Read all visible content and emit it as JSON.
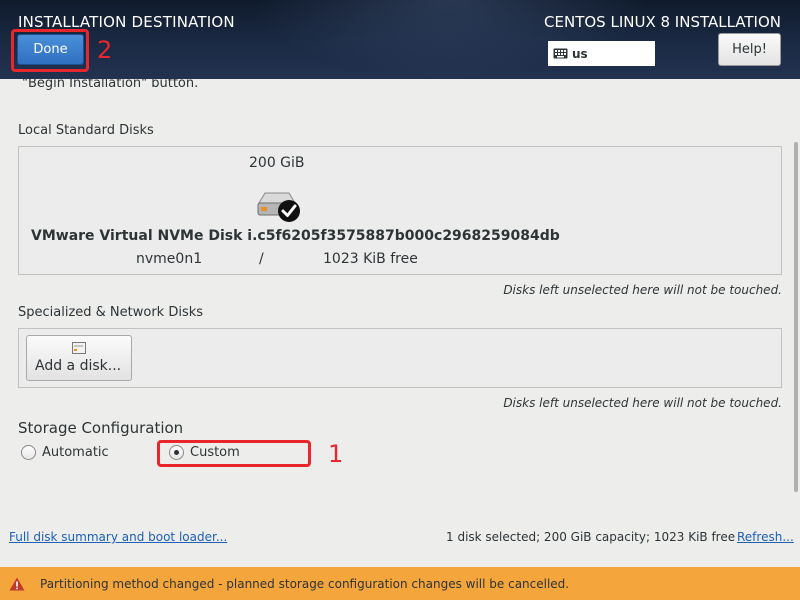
{
  "header": {
    "title": "INSTALLATION DESTINATION",
    "product": "CENTOS LINUX 8 INSTALLATION",
    "done_label": "Done",
    "keyboard_layout": "us",
    "help_label": "Help!"
  },
  "content": {
    "cut_text": "\"Begin Installation\" button.",
    "local_disks": {
      "label": "Local Standard Disks",
      "disk": {
        "size": "200 GiB",
        "name": "VMware Virtual NVMe Disk i.c5f6205f3575887b000c2968259084db",
        "device": "nvme0n1",
        "mount": "/",
        "free": "1023 KiB free",
        "selected": true
      },
      "note": "Disks left unselected here will not be touched."
    },
    "network_disks": {
      "label": "Specialized & Network Disks",
      "add_disk_label": "Add a disk...",
      "note": "Disks left unselected here will not be touched."
    },
    "storage_config": {
      "title": "Storage Configuration",
      "options": [
        {
          "label": "Automatic",
          "checked": false
        },
        {
          "label": "Custom",
          "checked": true
        }
      ]
    }
  },
  "footer": {
    "summary_link": "Full disk summary and boot loader...",
    "status": "1 disk selected; 200 GiB capacity; 1023 KiB free",
    "refresh_link": "Refresh..."
  },
  "warning": {
    "text": "Partitioning method changed - planned storage configuration changes will be cancelled."
  },
  "annotations": [
    {
      "number": "1",
      "target": "Custom"
    },
    {
      "number": "2",
      "target": "Done"
    }
  ],
  "colors": {
    "accent_blue": "#2f6fc0",
    "warning_orange": "#f4a53b",
    "annotation_red": "#e8262c",
    "link_blue": "#1c5fb5"
  }
}
